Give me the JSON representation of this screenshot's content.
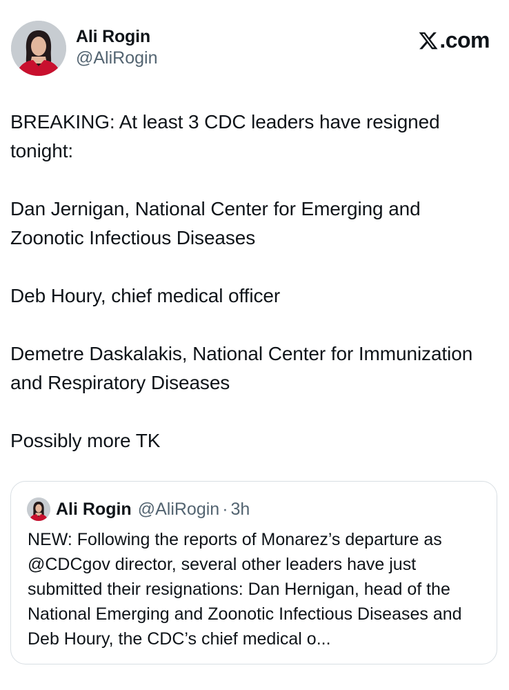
{
  "author": {
    "display_name": "Ali Rogin",
    "handle": "@AliRogin"
  },
  "site": {
    "logo_icon": "x-logo-icon",
    "label": ".com"
  },
  "post": {
    "paragraphs": [
      "BREAKING: At least 3 CDC leaders have resigned tonight:",
      "Dan Jernigan, National Center for Emerging and Zoonotic Infectious Diseases",
      "Deb Houry, chief medical officer",
      "Demetre Daskalakis, National Center for Immunization and Respiratory Diseases",
      "Possibly more TK"
    ]
  },
  "quoted_post": {
    "display_name": "Ali Rogin",
    "handle": "@AliRogin",
    "separator": "·",
    "time": "3h",
    "text": "NEW: Following the reports of Monarez’s departure as @CDCgov director, several other leaders have just submitted their resignations: Dan Hernigan, head of the National Emerging and Zoonotic Infectious Diseases and Deb Houry, the CDC’s chief medical o..."
  },
  "colors": {
    "text": "#0f1419",
    "secondary": "#536471",
    "border": "#d8dee3",
    "avatar_dress": "#c8102e"
  }
}
